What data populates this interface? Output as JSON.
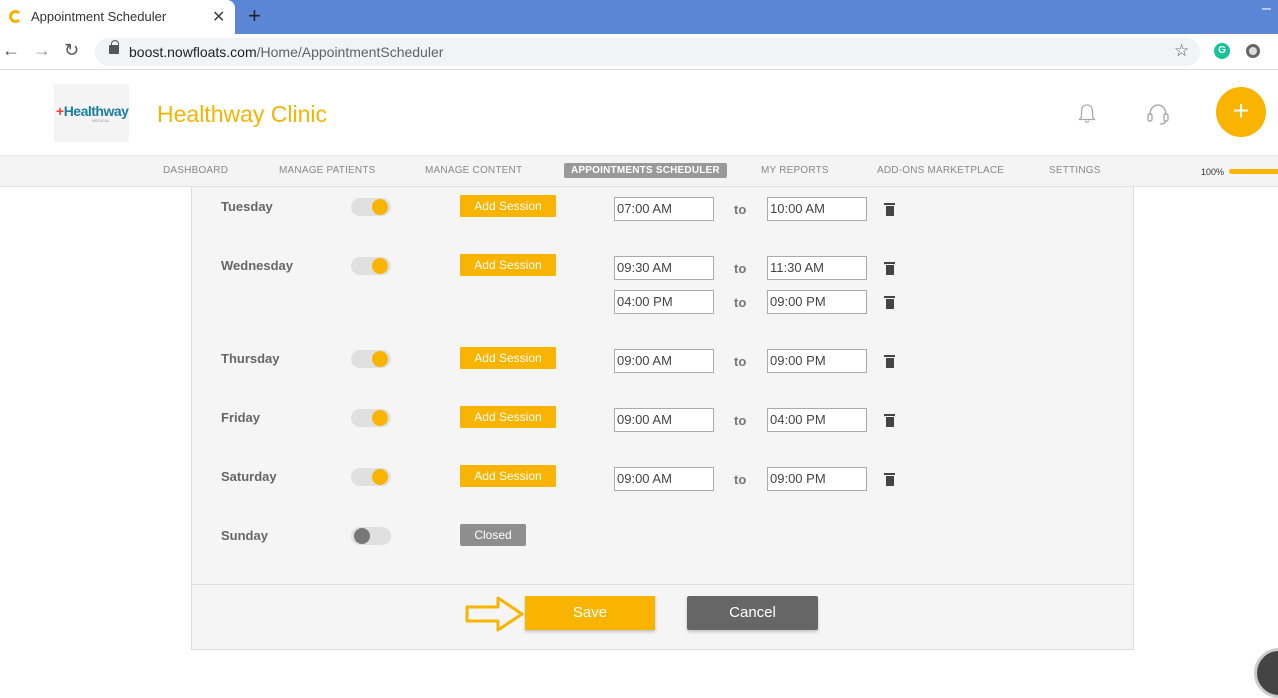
{
  "browser": {
    "tab_title": "Appointment Scheduler",
    "tab_close": "✕",
    "new_tab": "+",
    "minimize": "–",
    "back": "←",
    "forward": "→",
    "reload": "↻",
    "url_host": "boost.nowfloats.com",
    "url_path": "/Home/AppointmentScheduler",
    "star": "☆",
    "ext_grammarly": "G"
  },
  "header": {
    "logo_text": "Healthway",
    "logo_plus": "+",
    "logo_sub": "MEDICAL",
    "clinic_name": "Healthway Clinic",
    "fab_label": "+"
  },
  "nav": {
    "items": [
      "DASHBOARD",
      "MANAGE PATIENTS",
      "MANAGE CONTENT",
      "APPOINTMENTS SCHEDULER",
      "MY REPORTS",
      "ADD-ONS MARKETPLACE",
      "SETTINGS"
    ],
    "active_index": 3,
    "progress_label": "100%",
    "progress_value": 1.0
  },
  "schedule": {
    "add_session_label": "Add Session",
    "closed_label": "Closed",
    "to_label": "to",
    "days": [
      {
        "name": "Tuesday",
        "enabled": true,
        "sessions": [
          [
            "07:00 AM",
            "10:00 AM"
          ]
        ]
      },
      {
        "name": "Wednesday",
        "enabled": true,
        "sessions": [
          [
            "09:30 AM",
            "11:30 AM"
          ],
          [
            "04:00 PM",
            "09:00 PM"
          ]
        ]
      },
      {
        "name": "Thursday",
        "enabled": true,
        "sessions": [
          [
            "09:00 AM",
            "09:00 PM"
          ]
        ]
      },
      {
        "name": "Friday",
        "enabled": true,
        "sessions": [
          [
            "09:00 AM",
            "04:00 PM"
          ]
        ]
      },
      {
        "name": "Saturday",
        "enabled": true,
        "sessions": [
          [
            "09:00 AM",
            "09:00 PM"
          ]
        ]
      },
      {
        "name": "Sunday",
        "enabled": false,
        "sessions": []
      }
    ]
  },
  "actions": {
    "save_label": "Save",
    "cancel_label": "Cancel"
  },
  "colors": {
    "accent": "#f8b400",
    "tabbar": "#5b86d6",
    "cancel": "#666666"
  }
}
